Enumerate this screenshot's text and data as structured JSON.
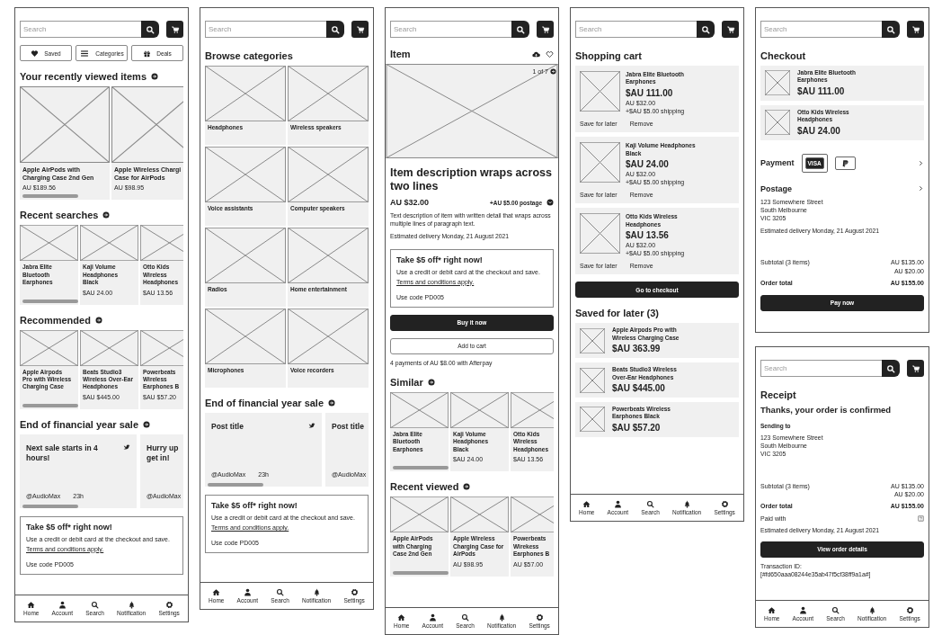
{
  "screens": [
    {
      "search": {
        "placeholder": "Search"
      },
      "blocks": [
        {
          "kind": "shortcuts",
          "items": [
            {
              "label": "Saved"
            },
            {
              "label": "Categories"
            },
            {
              "label": "Deals"
            }
          ]
        },
        {
          "kind": "heading",
          "text": "Your recently viewed items",
          "more": true
        },
        {
          "kind": "carousel_wide",
          "items": [
            {
              "title": "Apple AirPods with\nCharging Case 2nd Gen",
              "price": "AU $189.56"
            },
            {
              "title": "Apple Wireless Chargi\nCase for AirPods",
              "price": "AU $98.95"
            }
          ]
        },
        {
          "kind": "heading",
          "text": "Recent searches",
          "more": true
        },
        {
          "kind": "carousel_narrow",
          "items": [
            {
              "title": "Jabra Elite\nBluetooth\nEarphones"
            },
            {
              "title": "Kaji Volume\nHeadphones\nBlack",
              "price": "$AU 24.00"
            },
            {
              "title": "Otto Kids\nWireless\nHeadphones",
              "price": "$AU 13.56"
            }
          ]
        },
        {
          "kind": "heading",
          "text": "Recommended",
          "more": true
        },
        {
          "kind": "carousel_narrow",
          "items": [
            {
              "title": "Apple Airpods\nPro with Wireless\nCharging Case"
            },
            {
              "title": "Beats Studio3\nWireless Over-Ear\nHeadphones",
              "price": "$AU $445.00"
            },
            {
              "title": "Powerbeats\nWireless\nEarphones B",
              "price": "$AU $57.20"
            }
          ]
        },
        {
          "kind": "heading",
          "text": "End of financial year sale",
          "more": true
        },
        {
          "kind": "posts",
          "items": [
            {
              "title": "Next sale starts in 4\nhours!",
              "handle": "@AudioMax",
              "time": "23h",
              "social": true
            },
            {
              "title": "Hurry up\nget in!",
              "handle": "@AudioMax",
              "social": false
            }
          ]
        },
        {
          "kind": "promo",
          "title": "Take $5 off* right now!",
          "body": "Use a credit or debit card at the checkout and save.",
          "link": "Terms and conditions apply.",
          "code": "Use code PD005"
        }
      ],
      "tabbar": [
        {
          "label": "Home"
        },
        {
          "label": "Account"
        },
        {
          "label": "Search"
        },
        {
          "label": "Notification"
        },
        {
          "label": "Settings"
        }
      ]
    },
    {
      "search": {
        "placeholder": "Search"
      },
      "blocks": [
        {
          "kind": "heading",
          "text": "Browse categories",
          "more": false
        },
        {
          "kind": "grid",
          "items": [
            "Headphones",
            "Wireless speakers",
            "Voice assistants",
            "Computer speakers",
            "Radios",
            "Home entertainment",
            "Microphones",
            "Voice recorders"
          ]
        },
        {
          "kind": "heading",
          "text": "End of financial year sale",
          "more": true
        },
        {
          "kind": "posts",
          "items": [
            {
              "title": "Post title",
              "handle": "@AudioMax",
              "time": "23h",
              "social": true
            },
            {
              "title": "Post title",
              "handle": "@AudioMax",
              "social": false
            }
          ]
        },
        {
          "kind": "promo",
          "title": "Take $5 off* right now!",
          "body": "Use a credit or debit card at the checkout and save.",
          "link": "Terms and conditions apply.",
          "code": "Use code PD005"
        }
      ],
      "tabbar": [
        {
          "label": "Home"
        },
        {
          "label": "Account"
        },
        {
          "label": "Search"
        },
        {
          "label": "Notification"
        },
        {
          "label": "Settings"
        }
      ]
    },
    {
      "search": {
        "placeholder": "Search"
      },
      "blocks": [
        {
          "kind": "item_head",
          "text": "Item"
        },
        {
          "kind": "hero",
          "counter": "1 of 7"
        },
        {
          "kind": "title",
          "text": "Item description wraps across two lines"
        },
        {
          "kind": "price_row",
          "price": "AU $32.00",
          "postage": "+AU $5.00 postage"
        },
        {
          "kind": "text",
          "text": "Text description of item with written detail that wraps across multiple lines of paragraph text."
        },
        {
          "kind": "text",
          "text": "Estimated delivery Monday, 21 August 2021"
        },
        {
          "kind": "promo",
          "title": "Take $5 off* right now!",
          "body": "Use a credit or debit card at the checkout and save.",
          "link": "Terms and conditions apply.",
          "code": "Use code PD005"
        },
        {
          "kind": "button",
          "label": "Buy it now",
          "primary": true
        },
        {
          "kind": "button",
          "label": "Add to cart",
          "primary": false
        },
        {
          "kind": "text",
          "text": "4 payments of AU $8.00 with Afterpay"
        },
        {
          "kind": "heading",
          "text": "Similar",
          "more": true
        },
        {
          "kind": "carousel_narrow",
          "items": [
            {
              "title": "Jabra Elite\nBluetooth\nEarphones"
            },
            {
              "title": "Kaji Volume\nHeadphones\nBlack",
              "price": "$AU 24.00"
            },
            {
              "title": "Otto Kids\nWireless\nHeadphones",
              "price": "$AU 13.56"
            }
          ]
        },
        {
          "kind": "heading",
          "text": "Recent viewed",
          "more": true
        },
        {
          "kind": "carousel_narrow",
          "items": [
            {
              "title": "Apple AirPods\nwith Charging\nCase 2nd Gen"
            },
            {
              "title": "Apple Wireless\nCharging Case for\nAirPods",
              "price": "AU $98.95"
            },
            {
              "title": "Powerbeats\nWirekess\nEarphones B",
              "price": "AU $57.00"
            }
          ]
        }
      ],
      "tabbar": [
        {
          "label": "Home"
        },
        {
          "label": "Account"
        },
        {
          "label": "Search"
        },
        {
          "label": "Notification"
        },
        {
          "label": "Settings"
        }
      ]
    },
    {
      "search": {
        "placeholder": "Search"
      },
      "blocks": [
        {
          "kind": "heading",
          "text": "Shopping cart",
          "more": false
        },
        {
          "kind": "cart_item",
          "title": "Jabra Elite Bluetooth\nEarphones",
          "price": "$AU 111.00",
          "was": "AU $32.00",
          "shipping": "+$AU $5.00 shipping",
          "actions": [
            "Save for later",
            "Remove"
          ]
        },
        {
          "kind": "cart_item",
          "title": "Kaji Volume Headphones\nBlack",
          "price": "$AU 24.00",
          "was": "AU $32.00",
          "shipping": "+$AU $5.00 shipping",
          "actions": [
            "Save for later",
            "Remove"
          ]
        },
        {
          "kind": "cart_item",
          "title": "Otto Kids Wireless\nHeadphones",
          "price": "$AU 13.56",
          "was": "AU $32.00",
          "shipping": "+$AU $5.00 shipping",
          "actions": [
            "Save for later",
            "Remove"
          ]
        },
        {
          "kind": "button",
          "label": "Go to checkout",
          "primary": true
        },
        {
          "kind": "heading",
          "text": "Saved for later (3)",
          "more": false
        },
        {
          "kind": "saved_item",
          "title": "Apple Airpods Pro with\nWireless Charging Case",
          "price": "$AU 363.99"
        },
        {
          "kind": "saved_item",
          "title": "Beats Studio3 Wireless\nOver-Ear Headphones",
          "price": "$AU $445.00"
        },
        {
          "kind": "saved_item",
          "title": "Powerbeats Wireless\nEarphones Black",
          "price": "$AU $57.20"
        }
      ],
      "tabbar": [
        {
          "label": "Home"
        },
        {
          "label": "Account"
        },
        {
          "label": "Search"
        },
        {
          "label": "Notification"
        },
        {
          "label": "Settings"
        }
      ]
    },
    {
      "search": {
        "placeholder": "Search"
      },
      "blocks": [
        {
          "kind": "heading",
          "text": "Checkout",
          "more": false
        },
        {
          "kind": "saved_item",
          "title": "Jabra Elite Bluetooth\nEarphones",
          "price": "$AU 111.00"
        },
        {
          "kind": "saved_item",
          "title": "Otto Kids Wireless\nHeadphones",
          "price": "$AU 24.00"
        },
        {
          "kind": "payment",
          "label": "Payment",
          "card": "VISA"
        },
        {
          "kind": "link_heading",
          "text": "Postage"
        },
        {
          "kind": "text",
          "text": "123 Somewhere Street\nSouth Melbourne\nVIC 3205"
        },
        {
          "kind": "text",
          "text": "Estimated delivery Monday, 21 August 2021"
        },
        {
          "kind": "totals",
          "rows": [
            {
              "label": "Subtotal (3 items)",
              "values": [
                "AU $135.00",
                "AU $20.00"
              ],
              "bold": false
            },
            {
              "label": "Order total",
              "values": [
                "AU $155.00"
              ],
              "bold": true
            }
          ]
        },
        {
          "kind": "button",
          "label": "Pay now",
          "primary": true
        }
      ]
    },
    {
      "search": {
        "placeholder": "Search"
      },
      "blocks": [
        {
          "kind": "heading",
          "text": "Receipt",
          "more": false
        },
        {
          "kind": "subheading",
          "text": "Thanks, your order is confirmed"
        },
        {
          "kind": "label",
          "text": "Sending to"
        },
        {
          "kind": "text",
          "text": "123 Somewhere Street\nSouth Melbourne\nVIC 3205"
        },
        {
          "kind": "totals",
          "rows": [
            {
              "label": "Subtotal (3 items)",
              "values": [
                "AU $135.00",
                "AU $20.00"
              ],
              "bold": false
            },
            {
              "label": "Order total",
              "values": [
                "AU $155.00"
              ],
              "bold": true
            }
          ]
        },
        {
          "kind": "paid_with",
          "label": "Paid with"
        },
        {
          "kind": "text",
          "text": "Estimated delivery Monday, 21 August 2021"
        },
        {
          "kind": "button",
          "label": "View order details",
          "primary": true
        },
        {
          "kind": "text",
          "text": "Transaction ID:\n[#fd650aaa08244e35ab47f5cf38ff9a1a#]"
        }
      ],
      "tabbar": [
        {
          "label": "Home"
        },
        {
          "label": "Account"
        },
        {
          "label": "Search"
        },
        {
          "label": "Notification"
        },
        {
          "label": "Settings"
        }
      ]
    }
  ]
}
